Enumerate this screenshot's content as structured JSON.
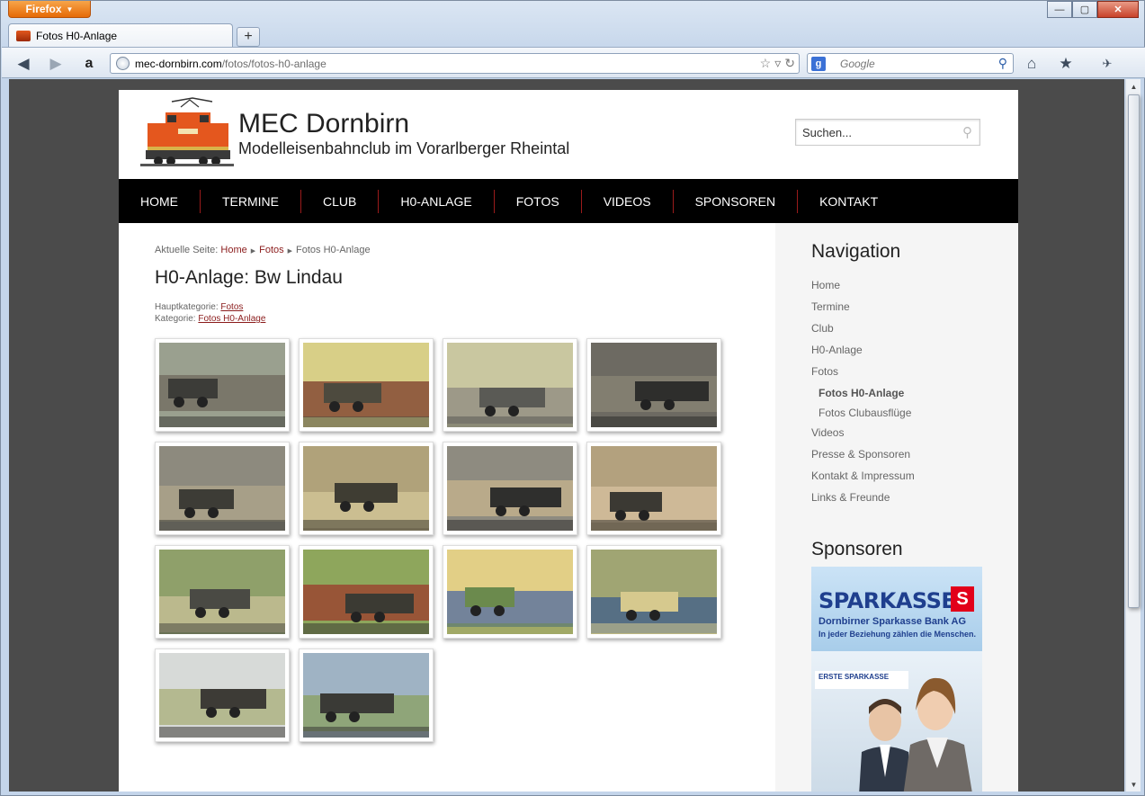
{
  "browser": {
    "app_button": "Firefox",
    "tab_title": "Fotos H0-Anlage",
    "url_host": "mec-dornbirn.com",
    "url_path": "/fotos/fotos-h0-anlage",
    "search_engine_icon": "google-icon",
    "search_placeholder": "Google"
  },
  "site": {
    "title": "MEC Dornbirn",
    "subtitle": "Modelleisenbahnclub im Vorarlberger Rheintal",
    "search_placeholder": "Suchen..."
  },
  "menu": [
    "HOME",
    "TERMINE",
    "CLUB",
    "H0-ANLAGE",
    "FOTOS",
    "VIDEOS",
    "SPONSOREN",
    "KONTAKT"
  ],
  "breadcrumb": {
    "prefix": "Aktuelle Seite:",
    "items": [
      "Home",
      "Fotos",
      "Fotos H0-Anlage"
    ]
  },
  "article": {
    "title": "H0-Anlage: Bw Lindau",
    "parent_label": "Hauptkategorie:",
    "parent_link": "Fotos",
    "category_label": "Kategorie:",
    "category_link": "Fotos H0-Anlage"
  },
  "gallery": [
    "roundhouse-locomotives",
    "yellow-shed-red-engine",
    "silos-steam-engine",
    "locomotive-depot",
    "coal-loading-crane",
    "tank-locomotive",
    "locomotive-figures",
    "turntable-locomotive",
    "aerial-depot-view",
    "tender-in-grass",
    "yellow-building-blue-car",
    "parking-lot-cars",
    "locomotives-behind-wall",
    "steam-engine-closeup"
  ],
  "sidebar": {
    "nav_heading": "Navigation",
    "nav": [
      {
        "label": "Home",
        "level": 0
      },
      {
        "label": "Termine",
        "level": 0
      },
      {
        "label": "Club",
        "level": 0
      },
      {
        "label": "H0-Anlage",
        "level": 0
      },
      {
        "label": "Fotos",
        "level": 0
      },
      {
        "label": "Fotos H0-Anlage",
        "level": 1,
        "active": true
      },
      {
        "label": "Fotos Clubausflüge",
        "level": 1
      },
      {
        "label": "Videos",
        "level": 0
      },
      {
        "label": "Presse & Sponsoren",
        "level": 0
      },
      {
        "label": "Kontakt & Impressum",
        "level": 0
      },
      {
        "label": "Links & Freunde",
        "level": 0
      }
    ],
    "sponsor_heading": "Sponsoren",
    "sponsor": {
      "name": "SPARKASSE",
      "logo_letter": "S",
      "line1": "Dornbirner Sparkasse Bank AG",
      "line2": "In jeder Beziehung zählen die Menschen.",
      "small_logo": "ERSTE SPARKASSE"
    }
  },
  "colors": {
    "menu_bg": "#000000",
    "menu_separator": "#9b1b1b",
    "link": "#8b1c1c",
    "sidebar_bg": "#f5f5f5"
  }
}
